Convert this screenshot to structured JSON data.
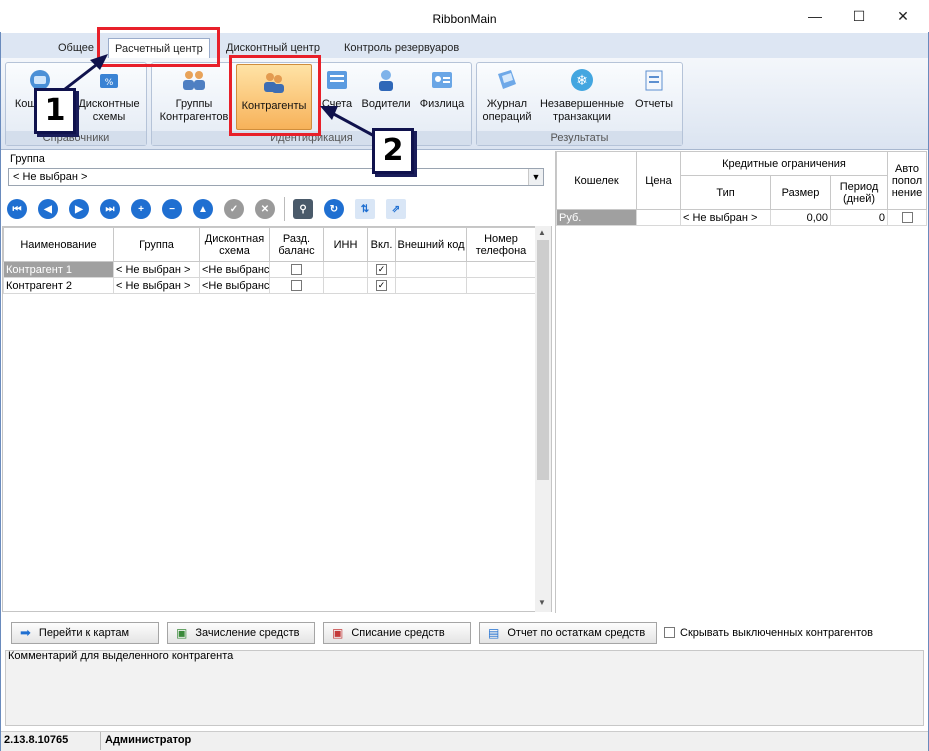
{
  "window": {
    "title": "RibbonMain",
    "minimize_label": "—",
    "maximize_label": "☐",
    "close_label": "✕"
  },
  "tabs": [
    "Общее",
    "Расчетный центр",
    "Дисконтный центр",
    "Контроль резервуаров"
  ],
  "ribbon": {
    "groups": [
      {
        "label": "Справочники",
        "buttons": [
          {
            "label": "Кошельки",
            "icon": "wallet-icon"
          },
          {
            "label": "Дисконтные схемы",
            "icon": "discount-icon"
          }
        ]
      },
      {
        "label": "Идентификация",
        "buttons": [
          {
            "label": "Группы Контрагентов",
            "icon": "groups-icon"
          },
          {
            "label": "Контрагенты",
            "icon": "contractors-icon"
          },
          {
            "label": "Счета",
            "icon": "accounts-icon"
          },
          {
            "label": "Водители",
            "icon": "drivers-icon"
          },
          {
            "label": "Физлица",
            "icon": "persons-icon"
          }
        ]
      },
      {
        "label": "Результаты",
        "buttons": [
          {
            "label": "Журнал операций",
            "icon": "journal-icon"
          },
          {
            "label": "Незавершенные транзакции",
            "icon": "snowflake-icon"
          },
          {
            "label": "Отчеты",
            "icon": "reports-icon"
          }
        ]
      }
    ]
  },
  "group_filter": {
    "label": "Группа",
    "value": "< Не выбран >"
  },
  "left_table": {
    "headers": [
      "Наименование",
      "Группа",
      "Дисконтная схема",
      "Разд. баланс",
      "ИНН",
      "Вкл.",
      "Внешний код",
      "Номер телефона"
    ],
    "rows": [
      {
        "name": "Контрагент 1",
        "group": "< Не выбран >",
        "scheme": "<Не выбранс",
        "split": false,
        "inn": "",
        "enabled": true,
        "ext": "",
        "phone": ""
      },
      {
        "name": "Контрагент 2",
        "group": "< Не выбран >",
        "scheme": "<Не выбранс",
        "split": false,
        "inn": "",
        "enabled": true,
        "ext": "",
        "phone": ""
      }
    ]
  },
  "right_table": {
    "headers": {
      "wallet": "Кошелек",
      "price": "Цена",
      "credit": "Кредитные ограничения",
      "type": "Тип",
      "size": "Размер",
      "period": "Период (дней)",
      "auto": "Авто попол нение"
    },
    "rows": [
      {
        "wallet": "Руб.",
        "price": "",
        "type": "< Не выбран >",
        "size": "0,00",
        "period": "0",
        "auto": false
      }
    ]
  },
  "buttons": {
    "go_cards": "Перейти к картам",
    "credit_funds": "Зачисление средств",
    "debit_funds": "Списание средств",
    "balance_report": "Отчет по остаткам средств",
    "hide_disabled": "Скрывать выключенных контрагентов"
  },
  "comment_label": "Комментарий для выделенного контрагента",
  "status": {
    "version": "2.13.8.10765",
    "user": "Администратор"
  },
  "annotations": {
    "callout_1": "1",
    "callout_2": "2"
  },
  "colors": {
    "accent_red": "#e8202a",
    "callout_navy": "#10124d",
    "active_button": "#f7b25a",
    "toolbar_blue": "#1f6fd1"
  }
}
